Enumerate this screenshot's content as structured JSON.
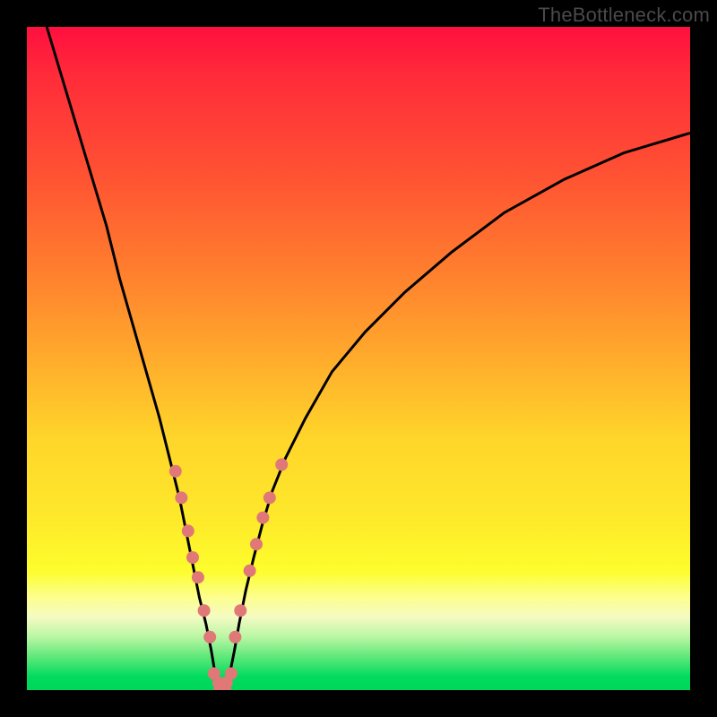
{
  "watermark": "TheBottleneck.com",
  "chart_data": {
    "type": "line",
    "title": "",
    "xlabel": "",
    "ylabel": "",
    "xlim": [
      0,
      100
    ],
    "ylim": [
      0,
      100
    ],
    "grid": false,
    "legend": false,
    "series": [
      {
        "name": "left-curve",
        "x": [
          3,
          6,
          9,
          12,
          14,
          16,
          18,
          20,
          21.5,
          23,
          24,
          25,
          26,
          27,
          27.8,
          28.3,
          28.8
        ],
        "y": [
          100,
          90,
          80,
          70,
          62,
          55,
          48,
          41,
          35,
          29,
          24,
          19,
          14,
          10,
          6,
          3,
          0
        ]
      },
      {
        "name": "right-curve",
        "x": [
          30.2,
          30.7,
          31.3,
          32,
          33,
          34.2,
          35.5,
          37,
          39,
          42,
          46,
          51,
          57,
          64,
          72,
          81,
          90,
          100
        ],
        "y": [
          0,
          3,
          6,
          10,
          15,
          20,
          25,
          30,
          35,
          41,
          48,
          54,
          60,
          66,
          72,
          77,
          81,
          84
        ]
      },
      {
        "name": "valley-floor",
        "x": [
          28.8,
          29.5,
          30.2
        ],
        "y": [
          0,
          0,
          0
        ]
      }
    ],
    "markers": {
      "left": [
        {
          "x": 22.4,
          "y": 33
        },
        {
          "x": 23.3,
          "y": 29
        },
        {
          "x": 24.3,
          "y": 24
        },
        {
          "x": 25.0,
          "y": 20
        },
        {
          "x": 25.8,
          "y": 17
        },
        {
          "x": 26.7,
          "y": 12
        },
        {
          "x": 27.6,
          "y": 8
        }
      ],
      "right": [
        {
          "x": 31.4,
          "y": 8
        },
        {
          "x": 32.2,
          "y": 12
        },
        {
          "x": 33.6,
          "y": 18
        },
        {
          "x": 34.6,
          "y": 22
        },
        {
          "x": 35.6,
          "y": 26
        },
        {
          "x": 36.6,
          "y": 29
        },
        {
          "x": 38.4,
          "y": 34
        }
      ],
      "floor": [
        {
          "x": 28.2,
          "y": 2.5
        },
        {
          "x": 28.9,
          "y": 1.1
        },
        {
          "x": 29.5,
          "y": 0.9
        },
        {
          "x": 30.1,
          "y": 1.1
        },
        {
          "x": 30.8,
          "y": 2.5
        }
      ]
    }
  },
  "colors": {
    "marker": "#e07878",
    "curve": "#000000"
  }
}
